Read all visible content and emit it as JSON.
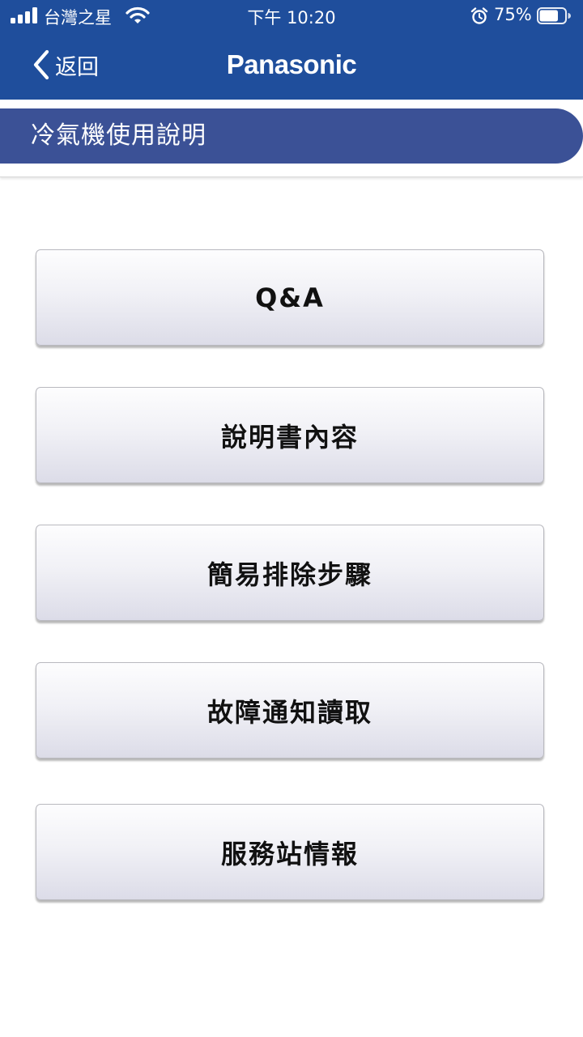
{
  "status_bar": {
    "carrier": "台灣之星",
    "time": "下午 10:20",
    "battery_percent": "75%",
    "battery_level": 0.75,
    "icons": [
      "signal-icon",
      "wifi-icon",
      "alarm-icon",
      "battery-icon"
    ]
  },
  "nav": {
    "back_label": "返回",
    "brand": "Panasonic"
  },
  "section": {
    "title": "冷氣機使用說明"
  },
  "menu": {
    "items": [
      {
        "label": "Q&A"
      },
      {
        "label": "說明書內容"
      },
      {
        "label": "簡易排除步驟"
      },
      {
        "label": "故障通知讀取"
      },
      {
        "label": "服務站情報"
      }
    ]
  },
  "colors": {
    "nav_bar": "#1f4e9c",
    "section_header": "#3b5196",
    "button_text": "#111111"
  }
}
